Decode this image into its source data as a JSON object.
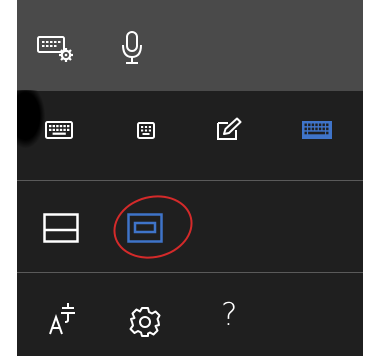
{
  "colors": {
    "panel_bg": "#1f1f1f",
    "top_bar_bg": "#4a4a4a",
    "icon": "#ffffff",
    "accent": "#3f74c9",
    "annotation": "#d42a2a"
  },
  "top_bar": {
    "icons": [
      "keyboard-settings-icon",
      "microphone-icon"
    ]
  },
  "keyboard_layouts": {
    "icons": [
      "default-keyboard-icon",
      "small-keyboard-icon",
      "handwriting-icon",
      "full-keyboard-icon"
    ],
    "selected": "full-keyboard-icon"
  },
  "docking": {
    "icons": [
      "docked-keyboard-icon",
      "undocked-keyboard-icon"
    ],
    "selected": "undocked-keyboard-icon"
  },
  "bottom_row": {
    "icons": [
      "text-language-icon",
      "settings-gear-icon",
      "help-icon"
    ],
    "help_glyph": "?"
  }
}
